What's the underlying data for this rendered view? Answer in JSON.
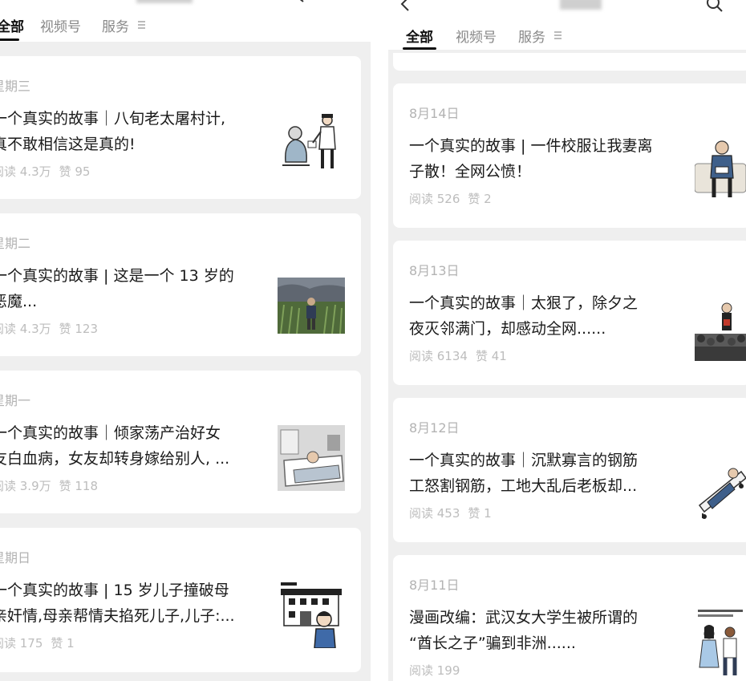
{
  "left_panel": {
    "tabs": [
      {
        "label": "全部",
        "active": true
      },
      {
        "label": "视频号",
        "active": false
      },
      {
        "label": "服务",
        "active": false
      }
    ],
    "articles": [
      {
        "date": "星期三",
        "title_lines": [
          "一个真实的故事｜八旬老太屠村计,",
          "真不敢相信这是真的!"
        ],
        "reads": "阅读 4.3万",
        "likes": "赞 95",
        "thumb_icon": "old-woman-and-police-illustration"
      },
      {
        "date": "星期二",
        "title_lines": [
          "一个真实的故事 |  这是一个 13 岁的",
          "恶魔..."
        ],
        "reads": "阅读 4.3万",
        "likes": "赞 123",
        "thumb_icon": "child-in-cornfield-photo"
      },
      {
        "date": "星期一",
        "title_lines": [
          "一个真实的故事｜倾家荡产治好女",
          "友白血病，女友却转身嫁给别人, ..."
        ],
        "reads": "阅读 3.9万",
        "likes": "赞 118",
        "thumb_icon": "patient-in-hospital-bed-illustration"
      },
      {
        "date": "星期日",
        "title_lines": [
          "一个真实的故事 | 15 岁儿子撞破母",
          "亲奸情,母亲帮情夫掐死儿子,儿子:..."
        ],
        "reads": "阅读 175",
        "likes": "赞 1",
        "thumb_icon": "boy-in-front-of-school-illustration"
      }
    ]
  },
  "right_panel": {
    "tabs": [
      {
        "label": "全部",
        "active": true
      },
      {
        "label": "视频号",
        "active": false
      },
      {
        "label": "服务",
        "active": false
      }
    ],
    "articles": [
      {
        "date": "8月14日",
        "title_lines": [
          "一个真实的故事 | 一件校服让我妻离",
          "子散！全网公愤！"
        ],
        "reads": "阅读 526",
        "likes": "赞 2",
        "thumb_icon": "man-on-sofa-illustration"
      },
      {
        "date": "8月13日",
        "title_lines": [
          "一个真实的故事｜太狠了，除夕之",
          "夜灭邻满门，却感动全网......"
        ],
        "reads": "阅读 6134",
        "likes": "赞 41",
        "thumb_icon": "courtroom-illustration"
      },
      {
        "date": "8月12日",
        "title_lines": [
          "一个真实的故事｜沉默寡言的钢筋",
          "工怒割钢筋，工地大乱后老板却..."
        ],
        "reads": "阅读 453",
        "likes": "赞 1",
        "thumb_icon": "worker-on-stretcher-illustration"
      },
      {
        "date": "8月11日",
        "title_lines": [
          "漫画改编：武汉女大学生被所谓的",
          "“酋长之子”骗到非洲......"
        ],
        "reads": "阅读 199",
        "likes": "",
        "thumb_icon": "comic-couple-illustration"
      }
    ]
  }
}
